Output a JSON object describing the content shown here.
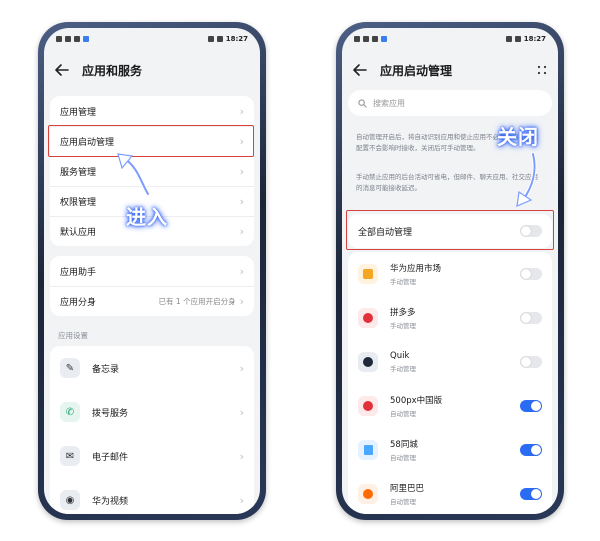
{
  "status_bar": {
    "time": "18:27"
  },
  "left_screen": {
    "title": "应用和服务",
    "group1": [
      {
        "label": "应用管理"
      },
      {
        "label": "应用启动管理"
      },
      {
        "label": "服务管理"
      },
      {
        "label": "权限管理"
      },
      {
        "label": "默认应用"
      }
    ],
    "group2": [
      {
        "label": "应用助手",
        "value": ""
      },
      {
        "label": "应用分身",
        "value": "已有 1 个应用开启分身"
      }
    ],
    "section_label": "应用设置",
    "settings_apps": [
      {
        "label": "备忘录",
        "icon": "memo-icon"
      },
      {
        "label": "拨号服务",
        "icon": "phone-icon"
      },
      {
        "label": "电子邮件",
        "icon": "mail-icon"
      },
      {
        "label": "华为视频",
        "icon": "video-icon"
      }
    ],
    "annotation": "进入"
  },
  "right_screen": {
    "title": "应用启动管理",
    "search_placeholder": "搜索应用",
    "desc1": "自动管理开启后，将自动识别应用和使止应用不必要的启动。此配置不会影响时接收，关闭后可手动管理。",
    "desc2": "手动禁止应用的后台活动可省电，但邮件、聊天应用、社交应用的消息可能接收延迟。",
    "master_label": "全部自动管理",
    "master_on": false,
    "apps": [
      {
        "name": "华为应用市场",
        "mode": "手动管理",
        "on": false,
        "icon_color": "#f5a623"
      },
      {
        "name": "拼多多",
        "mode": "手动管理",
        "on": false,
        "icon_color": "#e0303a"
      },
      {
        "name": "Quik",
        "mode": "手动管理",
        "on": false,
        "icon_color": "#1e2a3a"
      },
      {
        "name": "500px中国版",
        "mode": "自动管理",
        "on": true,
        "icon_color": "#e0303a"
      },
      {
        "name": "58同城",
        "mode": "自动管理",
        "on": true,
        "icon_color": "#4aa8ff"
      },
      {
        "name": "阿里巴巴",
        "mode": "自动管理",
        "on": true,
        "icon_color": "#ff6a00"
      }
    ],
    "annotation": "关闭"
  },
  "colors": {
    "accent": "#2b6df2",
    "highlight": "#d9413f",
    "annotation_glow": "#3a6dff"
  }
}
